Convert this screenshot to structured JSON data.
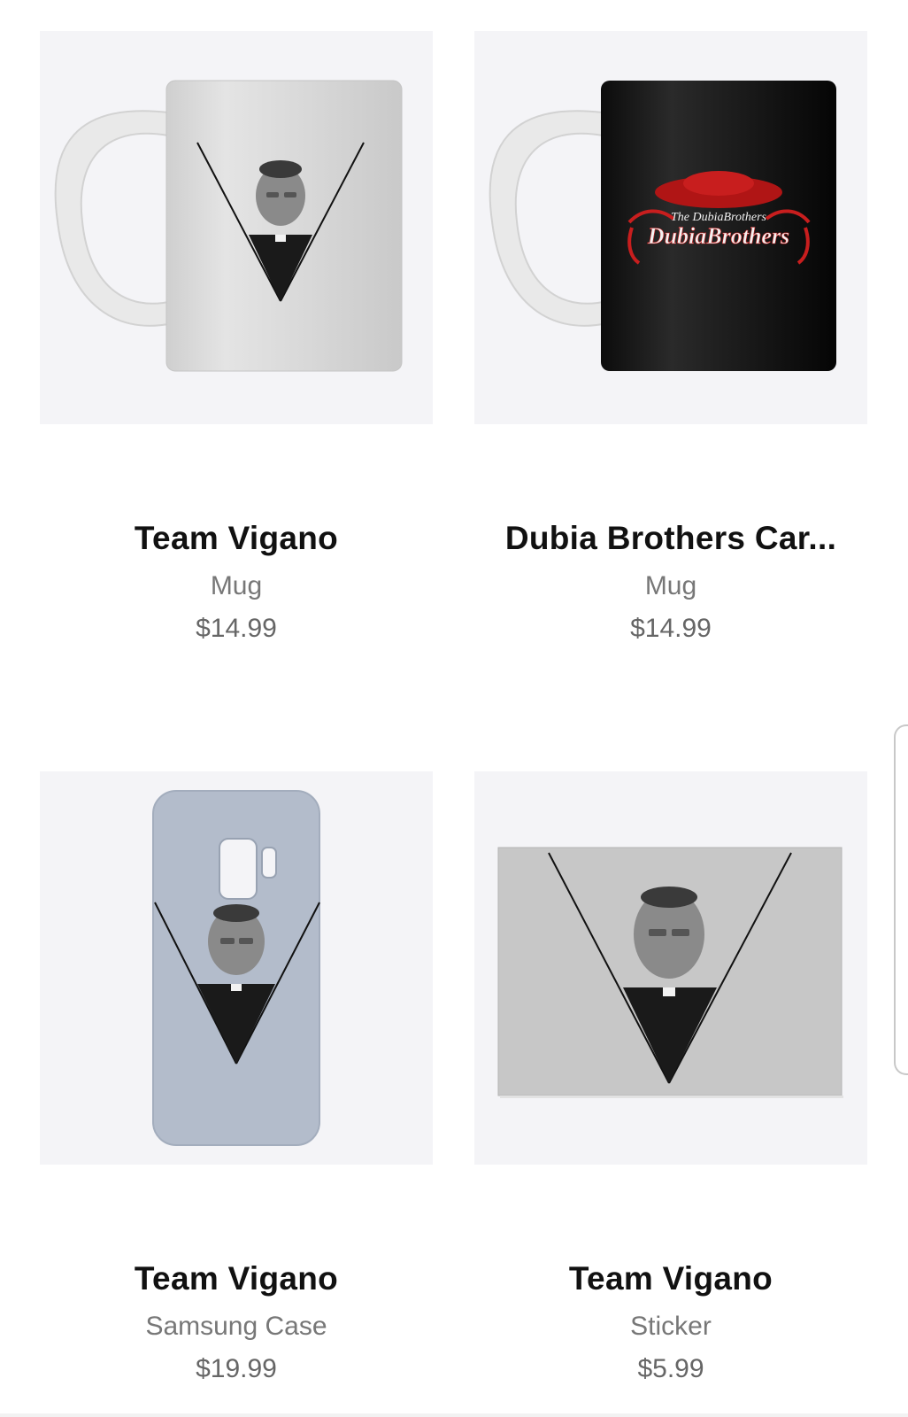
{
  "products": [
    {
      "title": "Team Vigano",
      "type": "Mug",
      "price": "$14.99",
      "image_icon": "white-mug-image"
    },
    {
      "title": "Dubia Brothers Car...",
      "type": "Mug",
      "price": "$14.99",
      "image_icon": "black-mug-image",
      "artwork_text": "The DubiaBrothers"
    },
    {
      "title": "Team Vigano",
      "type": "Samsung Case",
      "price": "$19.99",
      "image_icon": "phone-case-image"
    },
    {
      "title": "Team Vigano",
      "type": "Sticker",
      "price": "$5.99",
      "image_icon": "sticker-image"
    }
  ],
  "colors": {
    "thumb_bg": "#f4f4f7",
    "title": "#111111",
    "subtitle": "#777777",
    "price": "#666666",
    "accent_red": "#c81e1e"
  }
}
